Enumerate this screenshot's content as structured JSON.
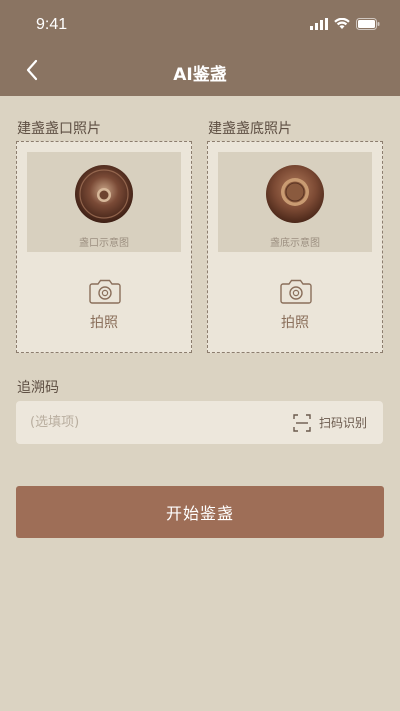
{
  "status_bar": {
    "time": "9:41"
  },
  "nav": {
    "title": "AI鉴盏"
  },
  "upload": {
    "mouth": {
      "label": "建盏盏口照片",
      "preview_caption": "盏口示意图",
      "shoot_label": "拍照"
    },
    "bottom": {
      "label": "建盏盏底照片",
      "preview_caption": "盏底示意图",
      "shoot_label": "拍照"
    }
  },
  "trace": {
    "label": "追溯码",
    "placeholder": "(选填项)",
    "scan_label": "扫码识别"
  },
  "actions": {
    "start_label": "开始鉴盏"
  },
  "colors": {
    "header": "#8a7462",
    "background": "#dbd3c2",
    "primary_button": "#9e6e57",
    "card": "#ebe5d9"
  },
  "icons": [
    "back-arrow-icon",
    "signal-icon",
    "wifi-icon",
    "battery-icon",
    "camera-icon",
    "scan-icon"
  ]
}
